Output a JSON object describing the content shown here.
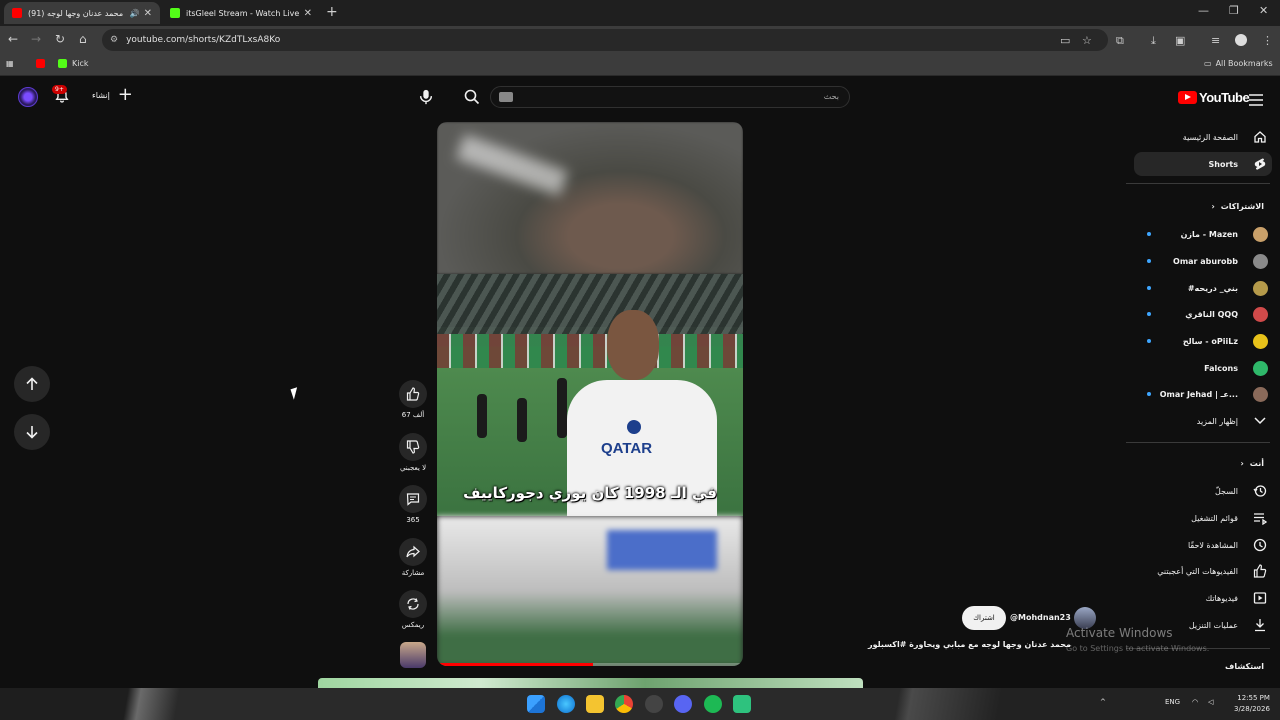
{
  "browser": {
    "tabs": [
      {
        "title": "(91) محمد عدنان وجها لوجه",
        "active": true,
        "favicon_color": "#ff0000"
      },
      {
        "title": "itsGleel Stream - Watch Live on",
        "active": false,
        "favicon_color": "#53fc18"
      }
    ],
    "url": "youtube.com/shorts/KZdTLxsA8Ko",
    "bookmarks": [
      {
        "label": "Kick",
        "color": "#53fc18"
      }
    ],
    "all_bookmarks": "All Bookmarks"
  },
  "youtube": {
    "logo": "YouTube",
    "search_placeholder": "بحث",
    "create_label": "إنشاء",
    "notifications_badge": "9+"
  },
  "sidebar": {
    "home": "الصفحة الرئيسية",
    "shorts": "Shorts",
    "subscriptions_header": "الاشتراكات",
    "subscriptions": [
      {
        "name": "مازن - Mazen",
        "color": "#c9a06a"
      },
      {
        "name": "Omar aburobb",
        "color": "#8a8a8a"
      },
      {
        "name": "#بني_ دريحه",
        "color": "#b59a4a"
      },
      {
        "name": "الناقري QQQ",
        "color": "#d04a4a"
      },
      {
        "name": "سالح - oPiiLz",
        "color": "#e8c21a"
      },
      {
        "name": "Falcons",
        "color": "#2fb86a"
      },
      {
        "name": "Omar Jehad | عـ...",
        "color": "#8a6a5a"
      }
    ],
    "show_more": "إظهار المزيد",
    "you_header": "أنت",
    "you_items": [
      {
        "label": "السجلّ",
        "icon": "history-icon"
      },
      {
        "label": "قوائم التشغيل",
        "icon": "playlist-icon"
      },
      {
        "label": "المشاهدة لاحقًا",
        "icon": "clock-icon"
      },
      {
        "label": "الفيديوهات التي أعجبتني",
        "icon": "thumbs-up-icon"
      },
      {
        "label": "فيديوهاتك",
        "icon": "play-square-icon"
      },
      {
        "label": "عمليات التنزيل",
        "icon": "download-icon"
      }
    ],
    "explore": "استكشاف"
  },
  "short": {
    "caption": "في الـ 1998 كان يوري دجوركاييف",
    "shirt_text": "QATAR",
    "progress": 0.51,
    "likes": "67 ألف",
    "dislike": "لا يعجبني",
    "comments": "365",
    "share": "مشاركة",
    "remix": "ريمكس",
    "channel_handle": "@Mohdnan23",
    "subscribe": "اشتراك",
    "title": "محمد عدنان وجها لوجه مع مبابي ويحاورة #اكسبلور"
  },
  "watermark": {
    "line1": "Activate Windows",
    "line2": "Go to Settings to activate Windows."
  },
  "taskbar": {
    "lang": "ENG",
    "time": "12:55 PM",
    "date": "3/28/2026"
  }
}
